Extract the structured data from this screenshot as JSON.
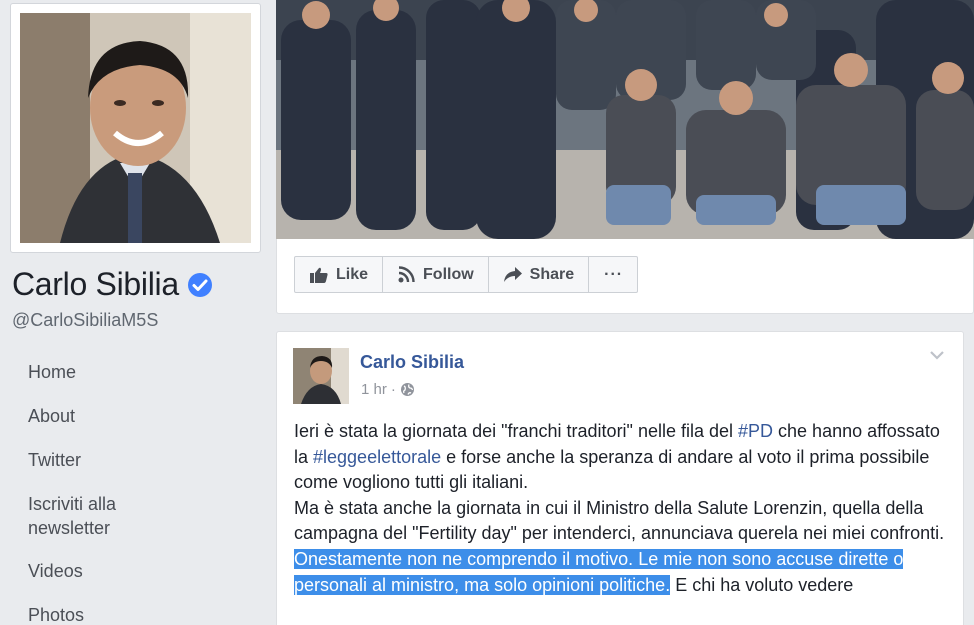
{
  "page": {
    "name": "Carlo Sibilia",
    "handle": "@CarloSibiliaM5S"
  },
  "nav": {
    "home": "Home",
    "about": "About",
    "twitter": "Twitter",
    "newsletter_line1": "Iscriviti alla",
    "newsletter_line2": "newsletter",
    "videos": "Videos",
    "photos": "Photos"
  },
  "actions": {
    "like": "Like",
    "follow": "Follow",
    "share": "Share",
    "more": "···"
  },
  "post": {
    "author": "Carlo Sibilia",
    "time": "1 hr",
    "dot": "·",
    "text": {
      "p1_a": "Ieri è stata la giornata dei \"franchi traditori\" nelle fila del ",
      "p1_tag1": "#PD",
      "p1_b": " che hanno affossato la ",
      "p1_tag2": "#leggeelettorale",
      "p1_c": " e forse anche la speranza di andare al voto il prima possibile come vogliono tutti gli italiani.",
      "p2": "Ma è stata anche la giornata in cui il Ministro della Salute Lorenzin, quella della campagna del \"Fertility day\" per intenderci, annunciava querela nei miei confronti.",
      "p3_selected": "Onestamente non ne comprendo il motivo. Le mie non sono accuse dirette o personali al ministro, ma solo opinioni politiche.",
      "p3_rest": " E chi ha voluto vedere"
    }
  },
  "colors": {
    "background": "#e9ebee",
    "link": "#365899",
    "verified": "#4080ff",
    "selection": "#3d8ee9"
  },
  "icons": {
    "verified": "verified-badge-icon",
    "like": "thumbs-up-icon",
    "follow": "rss-icon",
    "share": "share-arrow-icon",
    "privacy": "globe-icon",
    "menu": "chevron-down-icon"
  }
}
